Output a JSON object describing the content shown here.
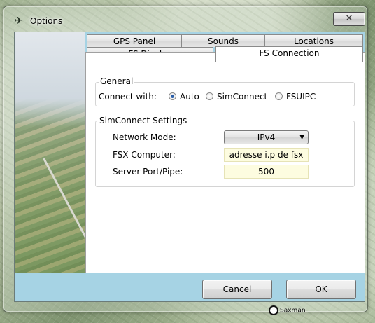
{
  "window": {
    "title": "Options",
    "close_glyph": "✕"
  },
  "tabs": {
    "row1": [
      "GPS Panel",
      "Sounds",
      "Locations"
    ],
    "row2": [
      "FS Display",
      "FS Connection"
    ],
    "active": "FS Connection"
  },
  "general": {
    "legend": "General",
    "connect_label": "Connect with:",
    "options": [
      "Auto",
      "SimConnect",
      "FSUIPC"
    ],
    "selected": "Auto"
  },
  "simconnect": {
    "legend": "SimConnect Settings",
    "network_mode_label": "Network Mode:",
    "network_mode_value": "IPv4",
    "fsx_computer_label": "FSX Computer:",
    "fsx_computer_value": "adresse i.p de fsx",
    "server_port_label": "Server Port/Pipe:",
    "server_port_value": "500"
  },
  "buttons": {
    "cancel": "Cancel",
    "ok": "OK"
  },
  "background": {
    "watermark_text": "Saxman"
  },
  "icons": {
    "title": "airplane-icon",
    "close": "close-icon",
    "dropdown": "chevron-down-icon"
  }
}
